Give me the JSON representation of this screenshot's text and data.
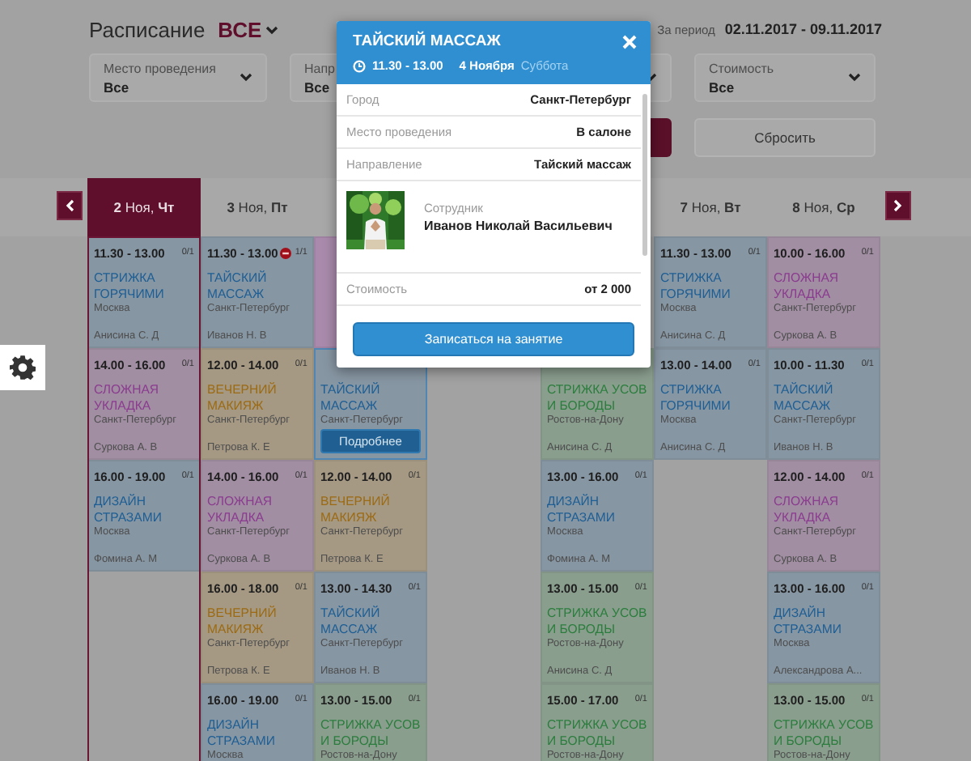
{
  "header": {
    "title": "Расписание",
    "filter": "ВСЕ",
    "period_label": "За период",
    "period": "02.11.2017 - 09.11.2017"
  },
  "filters": [
    {
      "kind": "select",
      "label": "Место проведения",
      "value": "Все"
    },
    {
      "kind": "clipped",
      "label": "Напр",
      "value": "Все"
    },
    {
      "kind": "covered"
    },
    {
      "kind": "select",
      "label": "Стоимость",
      "value": "Все"
    }
  ],
  "buttons": [
    {
      "kind": "apply"
    },
    {
      "kind": "reset",
      "label": "Сбросить"
    }
  ],
  "days": [
    {
      "kind": "day",
      "label": "**2** Ноя, **Чт**",
      "selected": true,
      "cells": [
        {
          "kind": "event",
          "time": "11.30 - 13.00",
          "count": "0/1",
          "full": false,
          "title": "СТРИЖКА ГОРЯЧИМИ",
          "city": "Москва",
          "person": "Анисина С. Д",
          "color": "#1d5e94"
        },
        {
          "kind": "event",
          "time": "14.00 - 16.00",
          "count": "0/1",
          "full": false,
          "title": "СЛОЖНАЯ УКЛАДКА",
          "city": "Санкт-Петербург",
          "person": "Суркова А. В",
          "color": "#8b3b8f"
        },
        {
          "kind": "event",
          "time": "16.00 - 19.00",
          "count": "0/1",
          "full": false,
          "title": "ДИЗАЙН СТРАЗАМИ",
          "city": "Москва",
          "person": "Фомина А. М",
          "color": "#1d5e94"
        }
      ]
    },
    {
      "kind": "day",
      "label": "**3** Ноя, **Пт**",
      "selected": false,
      "cells": [
        {
          "kind": "event",
          "time": "11.30 - 13.00",
          "count": "1/1",
          "full": true,
          "title": "ТАЙСКИЙ МАССАЖ",
          "city": "Санкт-Петербург",
          "person": "Иванов Н. В",
          "color": "#1d5e94"
        },
        {
          "kind": "event",
          "time": "12.00 - 14.00",
          "count": "0/1",
          "full": false,
          "title": "ВЕЧЕРНИЙ МАКИЯЖ",
          "city": "Санкт-Петербург",
          "person": "Петрова К. Е",
          "color": "#9c6a12"
        },
        {
          "kind": "event",
          "time": "14.00 - 16.00",
          "count": "0/1",
          "full": false,
          "title": "СЛОЖНАЯ УКЛАДКА",
          "city": "Санкт-Петербург",
          "person": "Суркова А. В",
          "color": "#8b3b8f"
        },
        {
          "kind": "event",
          "time": "16.00 - 18.00",
          "count": "0/1",
          "full": false,
          "title": "ВЕЧЕРНИЙ МАКИЯЖ",
          "city": "Санкт-Петербург",
          "person": "Петрова К. Е",
          "color": "#9c6a12"
        },
        {
          "kind": "event",
          "time": "16.00 - 19.00",
          "count": "0/1",
          "full": false,
          "title": "ДИЗАЙН СТРАЗАМИ",
          "city": "Москва",
          "color": "#1d5e94"
        }
      ]
    },
    {
      "kind": "covered",
      "cells": [
        {
          "kind": "block",
          "color": "#a98aac"
        },
        {
          "kind": "event",
          "full": false,
          "title": "ТАЙСКИЙ МАССАЖ",
          "city": "Санкт-Петербург",
          "action": "Подробнее",
          "color": "#1d5e94"
        },
        {
          "kind": "event",
          "time": "12.00 - 14.00",
          "count": "0/1",
          "full": false,
          "title": "ВЕЧЕРНИЙ МАКИЯЖ",
          "city": "Санкт-Петербург",
          "person": "Петрова К. Е",
          "color": "#9c6a12"
        },
        {
          "kind": "event",
          "time": "13.00 - 14.30",
          "count": "0/1",
          "full": false,
          "title": "ТАЙСКИЙ МАССАЖ",
          "city": "Санкт-Петербург",
          "person": "Иванов Н. В",
          "color": "#1d5e94"
        },
        {
          "kind": "event",
          "time": "13.00 - 15.00",
          "count": "0/1",
          "full": false,
          "title": "СТРИЖКА УСОВ И БОРОДЫ",
          "city": "Ростов-на-Дону",
          "color": "#2b7d3d"
        }
      ]
    },
    {
      "kind": "covered"
    },
    {
      "kind": "covered",
      "cells": [
        {
          "kind": "hidden"
        },
        {
          "kind": "event",
          "full": false,
          "title": "СТРИЖКА УСОВ И БОРОДЫ",
          "city": "Ростов-на-Дону",
          "person": "Анисина С. Д",
          "color": "#2b7d3d"
        },
        {
          "kind": "event",
          "time": "13.00 - 16.00",
          "count": "0/1",
          "full": false,
          "title": "ДИЗАЙН СТРАЗАМИ",
          "city": "Москва",
          "person": "Фомина А. М",
          "color": "#1d5e94"
        },
        {
          "kind": "event",
          "time": "13.00 - 15.00",
          "count": "0/1",
          "full": false,
          "title": "СТРИЖКА УСОВ И БОРОДЫ",
          "city": "Ростов-на-Дону",
          "person": "Анисина С. Д",
          "color": "#2b7d3d"
        },
        {
          "kind": "event",
          "time": "15.00 - 17.00",
          "count": "0/1",
          "full": false,
          "title": "СТРИЖКА УСОВ И БОРОДЫ",
          "city": "Ростов-на-Дону",
          "color": "#2b7d3d"
        }
      ]
    },
    {
      "kind": "day",
      "label": "**7** Ноя, **Вт**",
      "selected": false,
      "cells": [
        {
          "kind": "event",
          "time": "11.30 - 13.00",
          "count": "0/1",
          "full": false,
          "title": "СТРИЖКА ГОРЯЧИМИ",
          "city": "Москва",
          "person": "Анисина С. Д",
          "color": "#1d5e94"
        },
        {
          "kind": "event",
          "time": "13.00 - 14.00",
          "count": "0/1",
          "full": false,
          "title": "СТРИЖКА ГОРЯЧИМИ",
          "city": "Москва",
          "person": "Анисина С. Д",
          "color": "#1d5e94"
        }
      ]
    },
    {
      "kind": "day",
      "label": "**8** Ноя, **Ср**",
      "selected": false,
      "cells": [
        {
          "kind": "event",
          "time": "10.00 - 16.00",
          "count": "0/1",
          "full": false,
          "title": "СЛОЖНАЯ УКЛАДКА",
          "city": "Санкт-Петербург",
          "person": "Суркова А. В",
          "color": "#8b3b8f"
        },
        {
          "kind": "event",
          "time": "10.00 - 11.30",
          "count": "0/1",
          "full": false,
          "title": "ТАЙСКИЙ МАССАЖ",
          "city": "Санкт-Петербург",
          "person": "Иванов Н. В",
          "color": "#1d5e94"
        },
        {
          "kind": "event",
          "time": "12.00 - 14.00",
          "count": "0/1",
          "full": false,
          "title": "СЛОЖНАЯ УКЛАДКА",
          "city": "Санкт-Петербург",
          "person": "Суркова А. В",
          "color": "#8b3b8f"
        },
        {
          "kind": "event",
          "time": "13.00 - 16.00",
          "count": "0/1",
          "full": false,
          "title": "ДИЗАЙН СТРАЗАМИ",
          "city": "Москва",
          "person": "Александрова А...",
          "color": "#1d5e94"
        },
        {
          "kind": "event",
          "time": "13.00 - 15.00",
          "count": "0/1",
          "full": false,
          "title": "СТРИЖКА УСОВ И БОРОДЫ",
          "city": "Ростов-на-Дону",
          "color": "#2b7d3d"
        }
      ]
    }
  ],
  "popup": {
    "title": "ТАЙСКИЙ МАССАЖ",
    "time": "11.30 - 13.00",
    "date": "4 Ноября",
    "weekday": "Суббота",
    "rows": [
      {
        "kind": "field",
        "label": "Город",
        "value": "Санкт-Петербург"
      },
      {
        "kind": "field",
        "label": "Место проведения",
        "value": "В салоне"
      },
      {
        "kind": "field",
        "label": "Направление",
        "value": "Тайский массаж"
      },
      {
        "kind": "employee",
        "label": "Сотрудник",
        "value": "Иванов Николай Васильевич"
      },
      {
        "kind": "field",
        "label": "Стоимость",
        "value": "от 2 000"
      }
    ],
    "button": "Записаться на занятие"
  }
}
